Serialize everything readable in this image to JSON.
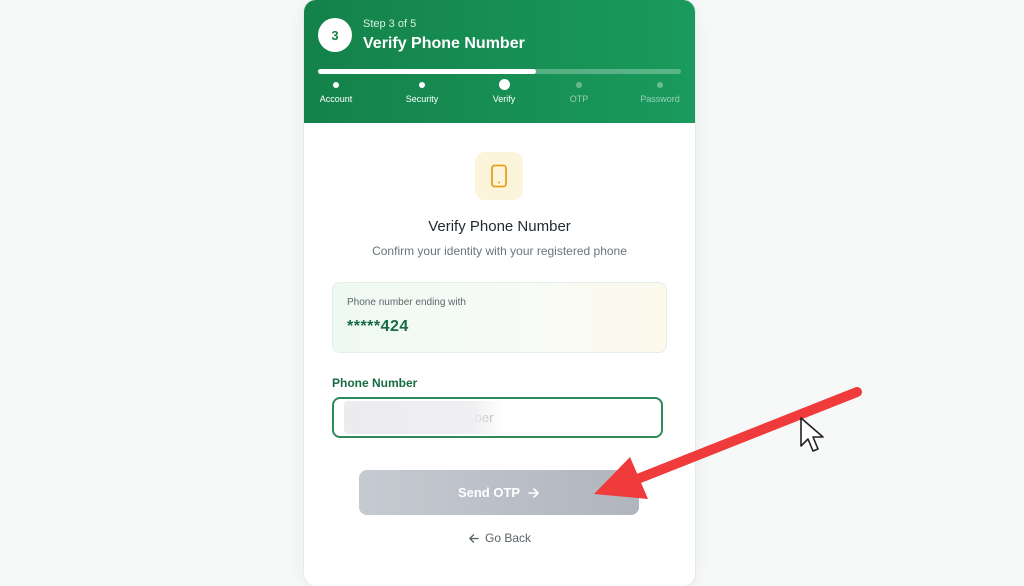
{
  "header": {
    "step_number": "3",
    "step_text": "Step 3 of 5",
    "title": "Verify Phone Number",
    "progress_percent": 60,
    "steps": [
      {
        "label": "Account",
        "state": "done"
      },
      {
        "label": "Security",
        "state": "done"
      },
      {
        "label": "Verify",
        "state": "current"
      },
      {
        "label": "OTP",
        "state": "upcoming"
      },
      {
        "label": "Password",
        "state": "upcoming"
      }
    ]
  },
  "main": {
    "icon": "smartphone-icon",
    "title": "Verify Phone Number",
    "subtitle": "Confirm your identity with your registered phone",
    "phone_caption": "Phone number ending with",
    "phone_masked": "*****424",
    "field_label": "Phone Number",
    "input_placeholder": "Enter your phone number",
    "send_label": "Send OTP",
    "back_label": "Go Back"
  },
  "colors": {
    "brand_green": "#14824a",
    "accent_red_arrow": "#ef3b3b",
    "icon_amber": "#e0a21c"
  }
}
